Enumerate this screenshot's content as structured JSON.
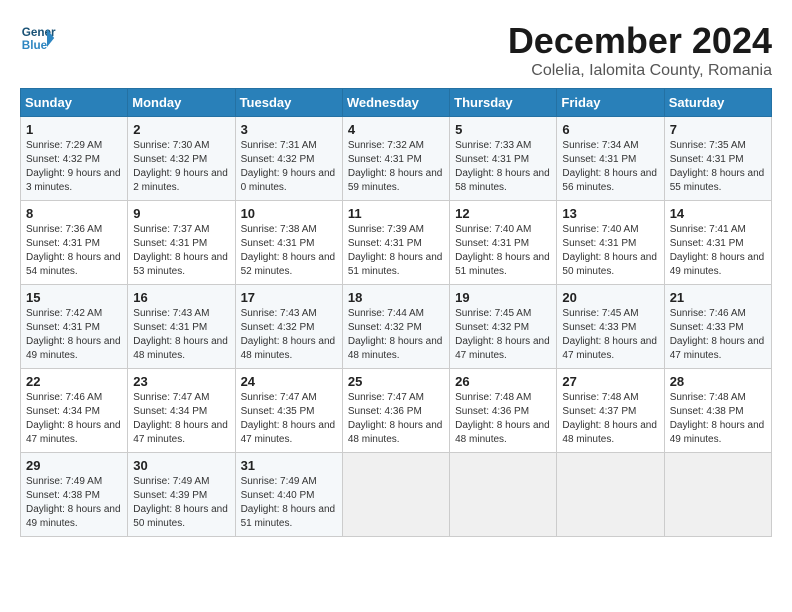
{
  "logo": {
    "general": "General",
    "blue": "Blue"
  },
  "title": "December 2024",
  "subtitle": "Colelia, Ialomita County, Romania",
  "weekdays": [
    "Sunday",
    "Monday",
    "Tuesday",
    "Wednesday",
    "Thursday",
    "Friday",
    "Saturday"
  ],
  "weeks": [
    [
      {
        "day": "1",
        "sunrise": "7:29 AM",
        "sunset": "4:32 PM",
        "daylight": "9 hours and 3 minutes."
      },
      {
        "day": "2",
        "sunrise": "7:30 AM",
        "sunset": "4:32 PM",
        "daylight": "9 hours and 2 minutes."
      },
      {
        "day": "3",
        "sunrise": "7:31 AM",
        "sunset": "4:32 PM",
        "daylight": "9 hours and 0 minutes."
      },
      {
        "day": "4",
        "sunrise": "7:32 AM",
        "sunset": "4:31 PM",
        "daylight": "8 hours and 59 minutes."
      },
      {
        "day": "5",
        "sunrise": "7:33 AM",
        "sunset": "4:31 PM",
        "daylight": "8 hours and 58 minutes."
      },
      {
        "day": "6",
        "sunrise": "7:34 AM",
        "sunset": "4:31 PM",
        "daylight": "8 hours and 56 minutes."
      },
      {
        "day": "7",
        "sunrise": "7:35 AM",
        "sunset": "4:31 PM",
        "daylight": "8 hours and 55 minutes."
      }
    ],
    [
      {
        "day": "8",
        "sunrise": "7:36 AM",
        "sunset": "4:31 PM",
        "daylight": "8 hours and 54 minutes."
      },
      {
        "day": "9",
        "sunrise": "7:37 AM",
        "sunset": "4:31 PM",
        "daylight": "8 hours and 53 minutes."
      },
      {
        "day": "10",
        "sunrise": "7:38 AM",
        "sunset": "4:31 PM",
        "daylight": "8 hours and 52 minutes."
      },
      {
        "day": "11",
        "sunrise": "7:39 AM",
        "sunset": "4:31 PM",
        "daylight": "8 hours and 51 minutes."
      },
      {
        "day": "12",
        "sunrise": "7:40 AM",
        "sunset": "4:31 PM",
        "daylight": "8 hours and 51 minutes."
      },
      {
        "day": "13",
        "sunrise": "7:40 AM",
        "sunset": "4:31 PM",
        "daylight": "8 hours and 50 minutes."
      },
      {
        "day": "14",
        "sunrise": "7:41 AM",
        "sunset": "4:31 PM",
        "daylight": "8 hours and 49 minutes."
      }
    ],
    [
      {
        "day": "15",
        "sunrise": "7:42 AM",
        "sunset": "4:31 PM",
        "daylight": "8 hours and 49 minutes."
      },
      {
        "day": "16",
        "sunrise": "7:43 AM",
        "sunset": "4:31 PM",
        "daylight": "8 hours and 48 minutes."
      },
      {
        "day": "17",
        "sunrise": "7:43 AM",
        "sunset": "4:32 PM",
        "daylight": "8 hours and 48 minutes."
      },
      {
        "day": "18",
        "sunrise": "7:44 AM",
        "sunset": "4:32 PM",
        "daylight": "8 hours and 48 minutes."
      },
      {
        "day": "19",
        "sunrise": "7:45 AM",
        "sunset": "4:32 PM",
        "daylight": "8 hours and 47 minutes."
      },
      {
        "day": "20",
        "sunrise": "7:45 AM",
        "sunset": "4:33 PM",
        "daylight": "8 hours and 47 minutes."
      },
      {
        "day": "21",
        "sunrise": "7:46 AM",
        "sunset": "4:33 PM",
        "daylight": "8 hours and 47 minutes."
      }
    ],
    [
      {
        "day": "22",
        "sunrise": "7:46 AM",
        "sunset": "4:34 PM",
        "daylight": "8 hours and 47 minutes."
      },
      {
        "day": "23",
        "sunrise": "7:47 AM",
        "sunset": "4:34 PM",
        "daylight": "8 hours and 47 minutes."
      },
      {
        "day": "24",
        "sunrise": "7:47 AM",
        "sunset": "4:35 PM",
        "daylight": "8 hours and 47 minutes."
      },
      {
        "day": "25",
        "sunrise": "7:47 AM",
        "sunset": "4:36 PM",
        "daylight": "8 hours and 48 minutes."
      },
      {
        "day": "26",
        "sunrise": "7:48 AM",
        "sunset": "4:36 PM",
        "daylight": "8 hours and 48 minutes."
      },
      {
        "day": "27",
        "sunrise": "7:48 AM",
        "sunset": "4:37 PM",
        "daylight": "8 hours and 48 minutes."
      },
      {
        "day": "28",
        "sunrise": "7:48 AM",
        "sunset": "4:38 PM",
        "daylight": "8 hours and 49 minutes."
      }
    ],
    [
      {
        "day": "29",
        "sunrise": "7:49 AM",
        "sunset": "4:38 PM",
        "daylight": "8 hours and 49 minutes."
      },
      {
        "day": "30",
        "sunrise": "7:49 AM",
        "sunset": "4:39 PM",
        "daylight": "8 hours and 50 minutes."
      },
      {
        "day": "31",
        "sunrise": "7:49 AM",
        "sunset": "4:40 PM",
        "daylight": "8 hours and 51 minutes."
      },
      null,
      null,
      null,
      null
    ]
  ]
}
